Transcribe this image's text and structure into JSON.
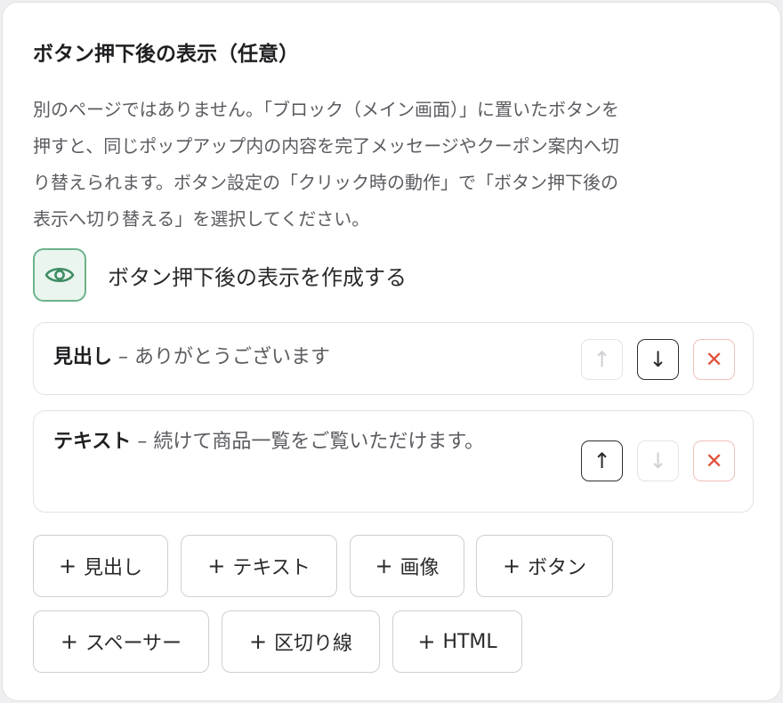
{
  "section": {
    "title": "ボタン押下後の表示（任意）",
    "description_lines": [
      "別のページではありません。「ブロック（メイン画面）」に置いたボタンを",
      "押すと、同じポップアップ内の内容を完了メッセージやクーポン案内へ切",
      "り替えられます。ボタン設定の「クリック時の動作」で「ボタン押下後の",
      "表示へ切り替える」を選択してください。"
    ],
    "create_label": "ボタン押下後の表示を作成する"
  },
  "items": [
    {
      "type_label": "見出し",
      "separator": " – ",
      "content": "ありがとうございます",
      "up_enabled": false,
      "down_enabled": true
    },
    {
      "type_label": "テキスト",
      "separator": " – ",
      "content": "続けて商品一覧をご覧いただけます。",
      "up_enabled": true,
      "down_enabled": false
    }
  ],
  "controls": {
    "up": "↑",
    "down": "↓",
    "delete": "✕"
  },
  "add_buttons": [
    {
      "plus": "+",
      "label": "見出し"
    },
    {
      "plus": "+",
      "label": "テキスト"
    },
    {
      "plus": "+",
      "label": "画像"
    },
    {
      "plus": "+",
      "label": "ボタン"
    },
    {
      "plus": "+",
      "label": "スペーサー"
    },
    {
      "plus": "+",
      "label": "区切り線"
    },
    {
      "plus": "+",
      "label": "HTML"
    }
  ],
  "colors": {
    "accent": "#6bb28b",
    "danger": "#e0503a"
  },
  "icons": {
    "create": "eye-icon"
  }
}
